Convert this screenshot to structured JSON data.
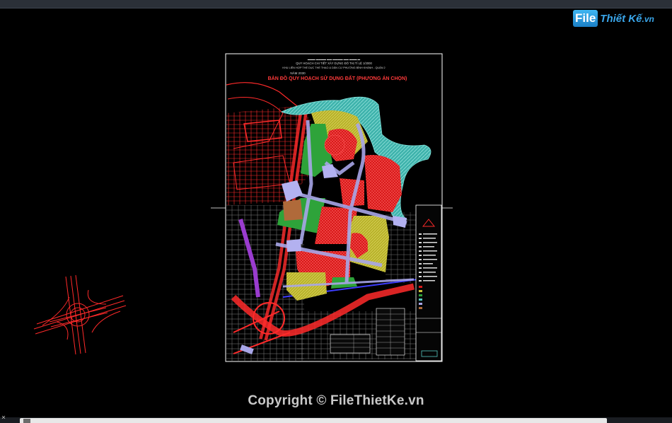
{
  "watermark_logo": {
    "tile_text": "File",
    "brand_text": "Thiết Kế",
    "domain_text": ".vn"
  },
  "drawing": {
    "title_line_1": "QUY HOẠCH CHI TIẾT XÂY DỰNG ĐÔ THỊ TỈ LỆ 1/2000",
    "title_line_2": "KHU LIÊN HỢP THỂ DỤC THỂ THAO & DÂN CƯ PHƯỜNG BÌNH KHÁNH - QUẬN 2",
    "year_text": "NĂM 2030",
    "map_title": "BẢN ĐỒ QUY HOẠCH SỬ DỤNG ĐẤT (PHƯƠNG ÁN CHỌN)"
  },
  "copyright": "Copyright © FileThietKe.vn",
  "status": {
    "prompt": "×"
  },
  "colors": {
    "background": "#000000",
    "cad_red": "#ff2a2a",
    "cad_white": "#ffffff",
    "water_cyan": "#56c8c0",
    "green_park": "#2ea33a",
    "yellow_zone": "#c9c23a",
    "road_lavender": "#a8a6e8",
    "purple_road": "#9a3ccf",
    "logo_blue": "#2f9fe6"
  }
}
